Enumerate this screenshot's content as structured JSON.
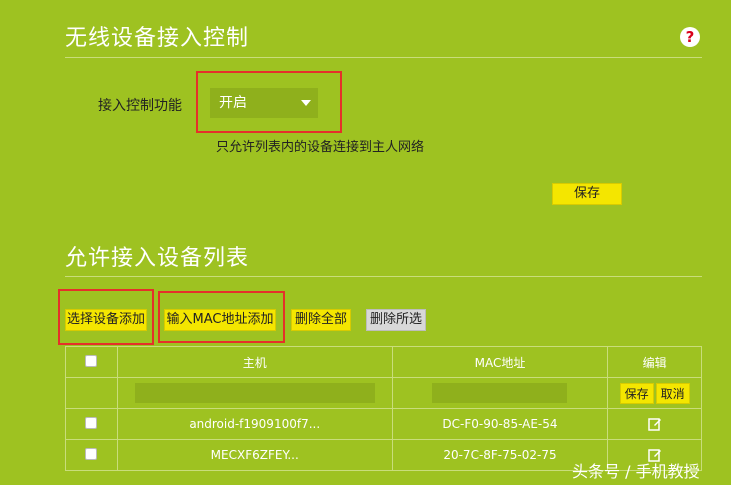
{
  "access_control": {
    "title": "无线设备接入控制",
    "feature_label": "接入控制功能",
    "select_value": "开启",
    "hint": "只允许列表内的设备连接到主人网络",
    "save_label": "保存"
  },
  "allowed_list": {
    "title": "允许接入设备列表",
    "buttons": {
      "select_device": "选择设备添加",
      "input_mac": "输入MAC地址添加",
      "delete_all": "删除全部",
      "delete_selected": "删除所选"
    },
    "table": {
      "headers": {
        "host": "主机",
        "mac": "MAC地址",
        "edit": "编辑"
      },
      "edit_row": {
        "save": "保存",
        "cancel": "取消"
      },
      "rows": [
        {
          "host": "android-f1909100f7...",
          "mac": "DC-F0-90-85-AE-54"
        },
        {
          "host": "MECXF6ZFEY...",
          "mac": "20-7C-8F-75-02-75"
        }
      ]
    }
  },
  "help_icon": "question-mark-icon",
  "watermark": "头条号 / 手机教授",
  "colors": {
    "background": "#9ec221",
    "button": "#f4e600",
    "highlight_box": "#e5302a",
    "help_icon_mark": "#d9001b"
  }
}
